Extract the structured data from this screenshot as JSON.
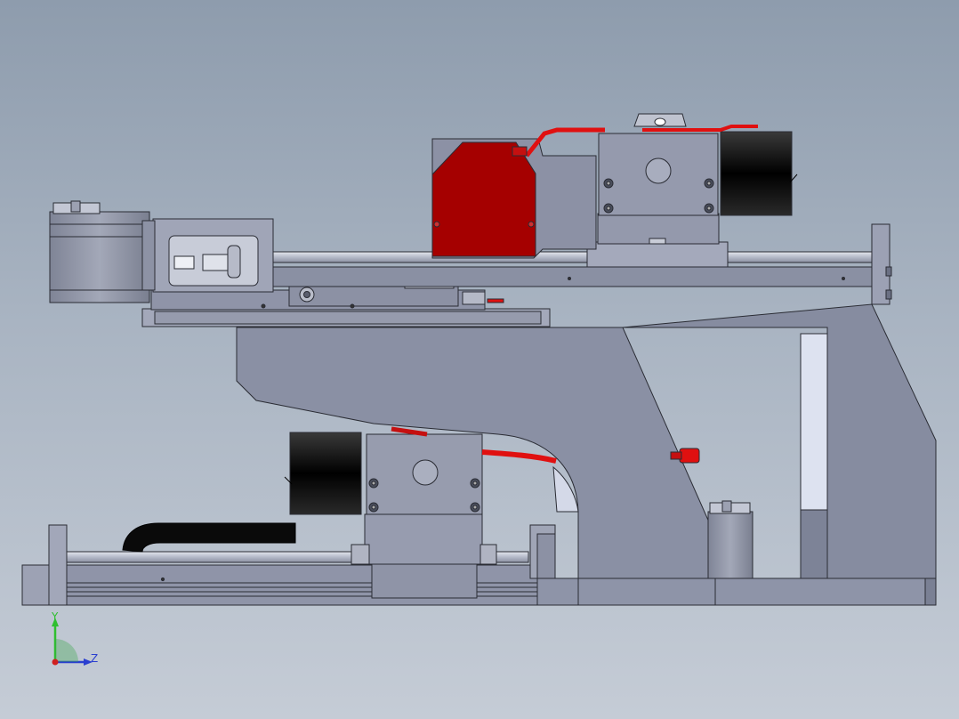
{
  "viewport": {
    "background_top": "#8e9cad",
    "background_bottom": "#c5ccd6"
  },
  "triad": {
    "y_label": "Y",
    "z_label": "Z",
    "y_color": "#2fbf2f",
    "z_color": "#2a3fd0",
    "x_color": "#d02020"
  },
  "colors": {
    "steel": "#8c92a6",
    "steel_light": "#a9aec0",
    "steel_dark": "#6f7488",
    "edge": "#2a2c34",
    "red_block": "#a50000",
    "red_cable": "#e01010",
    "motor_black": "#0a0a0a",
    "rail": "#c9cdd8",
    "light_panel": "#dde2f0"
  }
}
